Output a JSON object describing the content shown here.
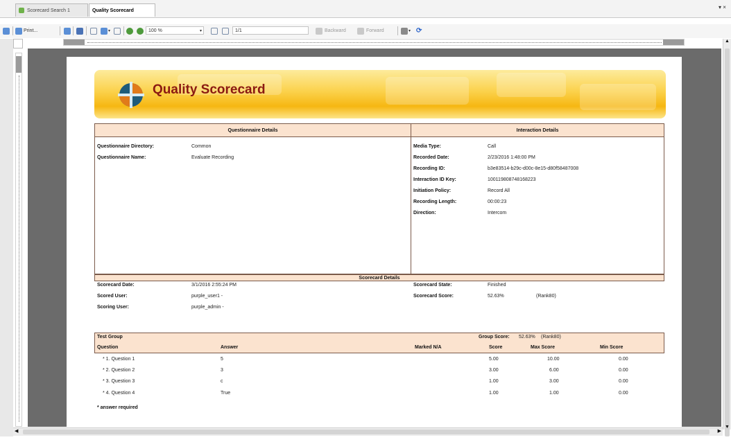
{
  "tabs": [
    {
      "label": "Scorecard Search 1"
    },
    {
      "label": "Quality Scorecard"
    }
  ],
  "tab_menu_glyph": "▾ ×",
  "toolbar": {
    "print_label": "Print...",
    "zoom": "100 %",
    "page": "1/1",
    "backward_label": "Backward",
    "forward_label": "Forward"
  },
  "report": {
    "banner_title": "Quality Scorecard",
    "questionnaire_section": {
      "header": "Questionnaire Details",
      "rows": [
        {
          "label": "Questionnaire Directory:",
          "value": "Common"
        },
        {
          "label": "Questionnaire Name:",
          "value": "Evaluate Recording"
        }
      ]
    },
    "interaction_section": {
      "header": "Interaction Details",
      "rows": [
        {
          "label": "Media Type:",
          "value": "Call"
        },
        {
          "label": "Recorded Date:",
          "value": "2/23/2016 1:48:00 PM"
        },
        {
          "label": "Recording ID:",
          "value": "b3e83514-b29c-d00c-8e15-d80f58487008"
        },
        {
          "label": "Interaction ID Key:",
          "value": "100119808748168223"
        },
        {
          "label": "Initiation Policy:",
          "value": "Record All"
        },
        {
          "label": "Recording Length:",
          "value": "00:00:23"
        },
        {
          "label": "Direction:",
          "value": "Intercom"
        }
      ]
    },
    "scorecard_section": {
      "header": "Scorecard Details",
      "left": [
        {
          "label": "Scorecard Date:",
          "value": "3/1/2016 2:55:24 PM"
        },
        {
          "label": "Scored User:",
          "value": "purple_user1 -"
        },
        {
          "label": "Scoring User:",
          "value": "purple_admin -"
        }
      ],
      "right": [
        {
          "label": "Scorecard State:",
          "value": "Finished",
          "extra": ""
        },
        {
          "label": "Scorecard Score:",
          "value": "52.63%",
          "extra": "(Rank80)"
        }
      ]
    },
    "test_group": {
      "title": "Test Group",
      "group_score_label": "Group Score:",
      "group_score": "52.63%",
      "group_rank": "(Rank80)",
      "columns": [
        "Question",
        "Answer",
        "Marked N/A",
        "Score",
        "Max Score",
        "Min Score"
      ],
      "rows": [
        {
          "question": "* 1. Question 1",
          "answer": "5",
          "na": "",
          "score": "5.00",
          "max": "10.00",
          "min": "0.00"
        },
        {
          "question": "* 2. Question 2",
          "answer": "3",
          "na": "",
          "score": "3.00",
          "max": "6.00",
          "min": "0.00"
        },
        {
          "question": "* 3. Question 3",
          "answer": "c",
          "na": "",
          "score": "1.00",
          "max": "3.00",
          "min": "0.00"
        },
        {
          "question": "* 4. Question 4",
          "answer": "True",
          "na": "",
          "score": "1.00",
          "max": "1.00",
          "min": "0.00"
        }
      ],
      "footnote": "* answer required"
    }
  },
  "colors": {
    "banner_title": "#8b1a12",
    "header_fill": "#fbe3cf",
    "canvas": "#6b6b6b"
  }
}
